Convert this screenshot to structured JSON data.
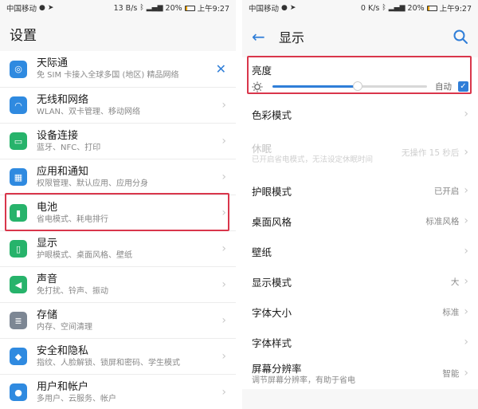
{
  "left": {
    "status": {
      "carrier": "中国移动",
      "speed": "13 B/s",
      "battery": "20%",
      "time": "上午9:27"
    },
    "title": "设置",
    "items": [
      {
        "title": "天际通",
        "subtitle": "免 SIM 卡接入全球多国 (地区) 精品网络",
        "icon": "globe-icon",
        "color": "#2f8ae0",
        "action": "close"
      },
      {
        "title": "无线和网络",
        "subtitle": "WLAN、双卡管理、移动网络",
        "icon": "wifi-icon",
        "color": "#2f8ae0"
      },
      {
        "title": "设备连接",
        "subtitle": "蓝牙、NFC、打印",
        "icon": "device-connect-icon",
        "color": "#27b36b"
      },
      {
        "title": "应用和通知",
        "subtitle": "权限管理、默认应用、应用分身",
        "icon": "apps-icon",
        "color": "#2f8ae0"
      },
      {
        "title": "电池",
        "subtitle": "省电模式、耗电排行",
        "icon": "battery-icon",
        "color": "#27b36b"
      },
      {
        "title": "显示",
        "subtitle": "护眼模式、桌面风格、壁纸",
        "icon": "display-icon",
        "color": "#27b36b"
      },
      {
        "title": "声音",
        "subtitle": "免打扰、铃声、振动",
        "icon": "sound-icon",
        "color": "#27b36b"
      },
      {
        "title": "存储",
        "subtitle": "内存、空间清理",
        "icon": "storage-icon",
        "color": "#7d8794"
      },
      {
        "title": "安全和隐私",
        "subtitle": "指纹、人脸解锁、锁屏和密码、学生模式",
        "icon": "shield-icon",
        "color": "#2f8ae0"
      },
      {
        "title": "用户和帐户",
        "subtitle": "多用户、云服务、帐户",
        "icon": "user-icon",
        "color": "#2f8ae0"
      }
    ]
  },
  "right": {
    "status": {
      "carrier": "中国移动",
      "speed": "0 K/s",
      "battery": "20%",
      "time": "上午9:27"
    },
    "title": "显示",
    "brightness": {
      "label": "亮度",
      "level": 0.55,
      "auto_label": "自动",
      "auto_checked": true
    },
    "rows": [
      {
        "label": "色彩模式",
        "value": ""
      },
      {
        "label": "休眠",
        "sub": "已开启省电模式，无法设定休眠时间",
        "value": "无操作 15 秒后",
        "disabled": true
      },
      {
        "label": "护眼模式",
        "value": "已开启"
      },
      {
        "label": "桌面风格",
        "value": "标准风格"
      },
      {
        "label": "壁纸",
        "value": ""
      },
      {
        "label": "显示模式",
        "value": "大"
      },
      {
        "label": "字体大小",
        "value": "标准"
      },
      {
        "label": "字体样式",
        "value": ""
      },
      {
        "label": "屏幕分辨率",
        "sub": "调节屏幕分辨率，有助于省电",
        "value": "智能"
      }
    ]
  },
  "colors": {
    "accent": "#2f7ed8",
    "highlight": "#d9364b"
  }
}
